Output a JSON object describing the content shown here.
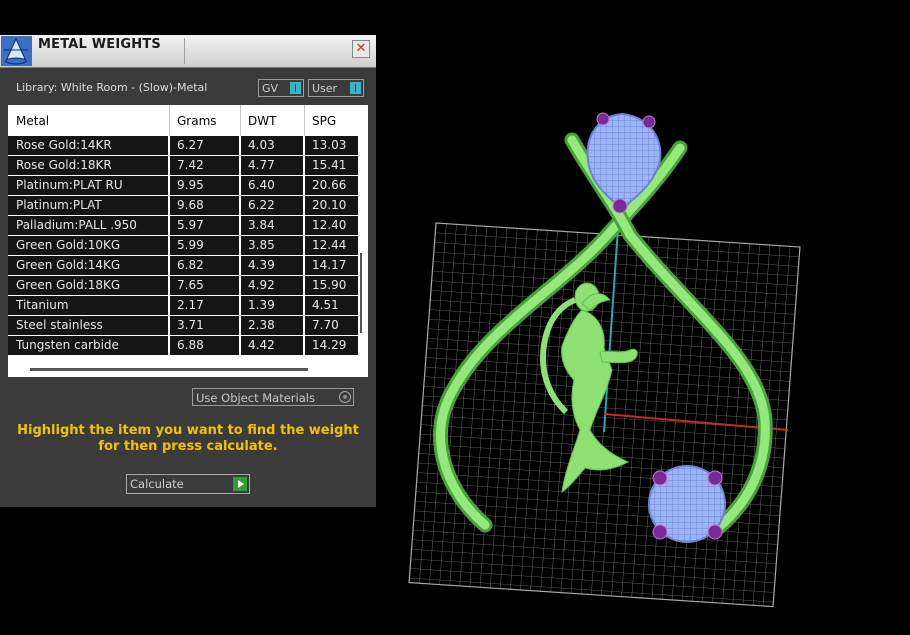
{
  "panel": {
    "title": "METAL WEIGHTS",
    "close_glyph": "✕",
    "library_label": "Library: White Room - (Slow)-Metal",
    "toggles": {
      "gv_label": "GV",
      "user_label": "User"
    },
    "columns": [
      "Metal",
      "Grams",
      "DWT",
      "SPG"
    ],
    "rows": [
      [
        "Rose Gold:14KR",
        "6.27",
        "4.03",
        "13.03"
      ],
      [
        "Rose Gold:18KR",
        "7.42",
        "4.77",
        "15.41"
      ],
      [
        "Platinum:PLAT RU",
        "9.95",
        "6.40",
        "20.66"
      ],
      [
        "Platinum:PLAT",
        "9.68",
        "6.22",
        "20.10"
      ],
      [
        "Palladium:PALL .950",
        "5.97",
        "3.84",
        "12.40"
      ],
      [
        "Green Gold:10KG",
        "5.99",
        "3.85",
        "12.44"
      ],
      [
        "Green Gold:14KG",
        "6.82",
        "4.39",
        "14.17"
      ],
      [
        "Green Gold:18KG",
        "7.65",
        "4.92",
        "15.90"
      ],
      [
        "Titanium",
        "2.17",
        "1.39",
        "4.51"
      ],
      [
        "Steel stainless",
        "3.71",
        "2.38",
        "7.70"
      ],
      [
        "Tungsten carbide",
        "6.88",
        "4.42",
        "14.29"
      ]
    ],
    "use_object_materials_label": "Use Object Materials",
    "instructions": "Highlight the item you want to find the weight for then press calculate.",
    "calculate_label": "Calculate"
  },
  "colors": {
    "instruction_text": "#f2c300",
    "model_green": "#86e06e",
    "gem_blue": "#8fa8ee",
    "prong_purple": "#8a2a9a",
    "toggle_knob": "#3ab3c2"
  },
  "icons": {
    "title": "cone-app-icon",
    "close": "close-icon",
    "calculate": "play-icon"
  }
}
